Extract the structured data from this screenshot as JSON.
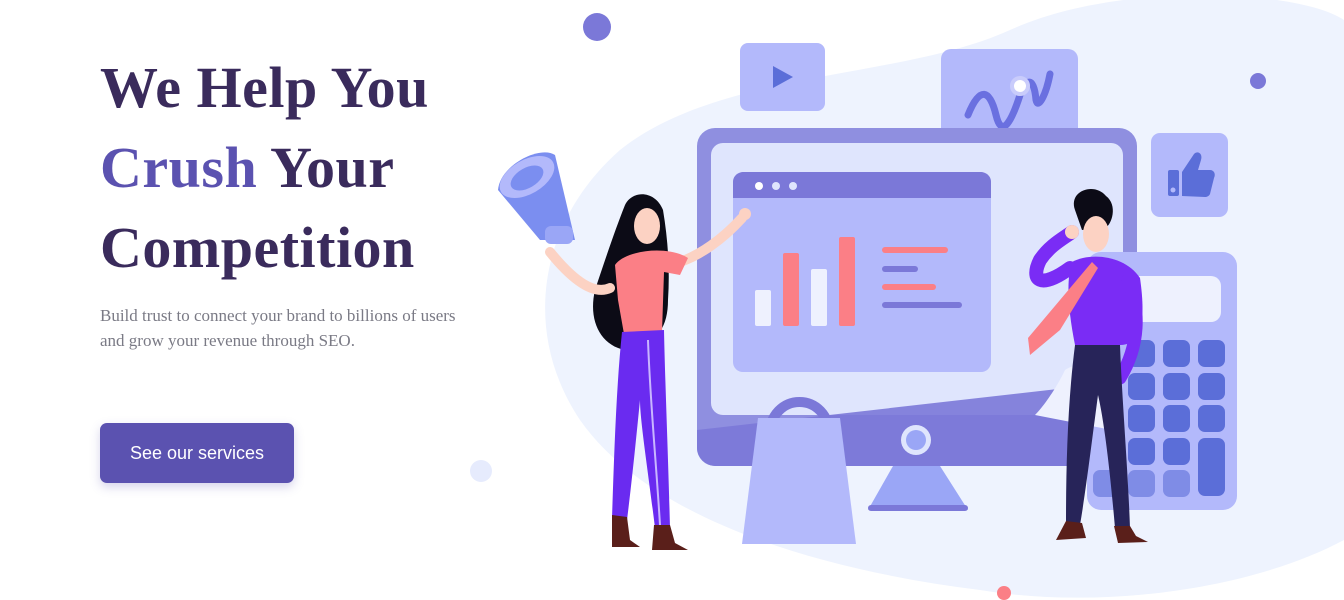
{
  "hero": {
    "headline": {
      "line1": "We Help You",
      "line2_accent": "Crush",
      "line2_rest": " Your",
      "line3": "Competition"
    },
    "subtext": "Build trust to connect your brand to billions of users and grow your revenue through SEO.",
    "cta_label": "See our services"
  },
  "colors": {
    "heading": "#3a2b5c",
    "accent": "#5b52b0",
    "body_text": "#7a7a85",
    "button_bg": "#5b52b0",
    "illustration_primary": "#7b78d8",
    "illustration_light": "#b3b9fb",
    "illustration_coral": "#fb7f86",
    "illustration_purple": "#6a2bf0"
  },
  "illustration": {
    "icons": [
      "play-icon",
      "wave-chart-icon",
      "thumbs-up-icon",
      "megaphone-icon",
      "shopping-bag-icon",
      "calculator-icon"
    ]
  }
}
